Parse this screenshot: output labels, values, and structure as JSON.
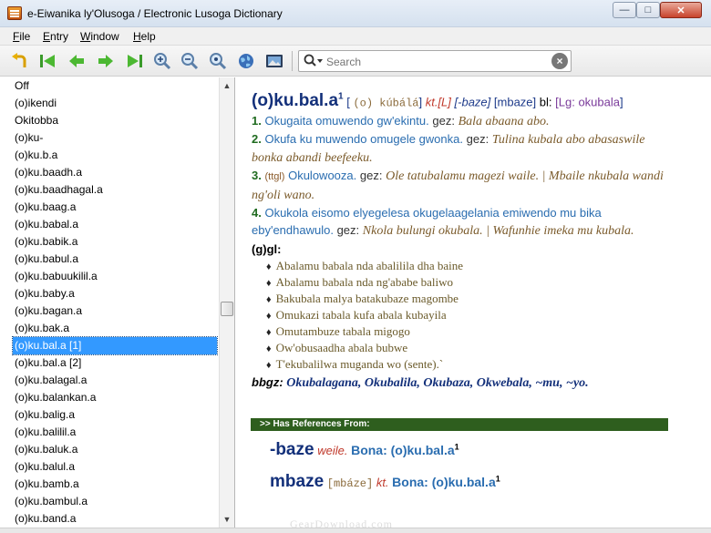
{
  "window": {
    "title": "e-Eiwanika ly'Olusoga / Electronic Lusoga Dictionary",
    "min_label": "—",
    "max_label": "□",
    "close_label": "✕"
  },
  "menu": {
    "items": [
      {
        "label": "File",
        "key": "F",
        "rest": "ile"
      },
      {
        "label": "Entry",
        "key": "E",
        "rest": "ntry"
      },
      {
        "label": "Window",
        "key": "W",
        "rest": "indow"
      },
      {
        "label": "Help",
        "key": "H",
        "rest": "elp"
      }
    ]
  },
  "toolbar": {
    "icons": [
      "undo-icon",
      "first-icon",
      "back-icon",
      "forward-icon",
      "last-icon",
      "zoom-in-icon",
      "zoom-out-icon",
      "zoom-reset-icon",
      "globe-icon",
      "image-icon"
    ],
    "search_placeholder": "Search"
  },
  "word_list": {
    "items": [
      "Off",
      "(o)ikendi",
      "Okitobba",
      "(o)ku-",
      "(o)ku.b.a",
      "(o)ku.baadh.a",
      "(o)ku.baadhagal.a",
      "(o)ku.baag.a",
      "(o)ku.babal.a",
      "(o)ku.babik.a",
      "(o)ku.babul.a",
      "(o)ku.babuukilil.a",
      "(o)ku.baby.a",
      "(o)ku.bagan.a",
      "(o)ku.bak.a",
      "(o)ku.bal.a [1]",
      "(o)ku.bal.a [2]",
      "(o)ku.balagal.a",
      "(o)ku.balankan.a",
      "(o)ku.balig.a",
      "(o)ku.balilil.a",
      "(o)ku.baluk.a",
      "(o)ku.balul.a",
      "(o)ku.bamb.a",
      "(o)ku.bambul.a",
      "(o)ku.band.a"
    ],
    "selected_index": 15
  },
  "entry": {
    "headword": "(o)ku.bal.a",
    "homonym": "1",
    "open_bracket": "[",
    "pron": "(o) kúbálá",
    "pos": "kt.[L]",
    "variant1": "[-baze]",
    "variant2": "[mbaze]",
    "bl_label": "bl:",
    "lg": "[Lg:",
    "lg_form": "okubala",
    "close_bracket": "]",
    "senses": [
      {
        "num": "1.",
        "def": "Okugaita omuwendo gw'ekintu.",
        "gez": "gez:",
        "ex": "Bala abaana abo."
      },
      {
        "num": "2.",
        "def": "Okufa ku muwendo omugele gwonka.",
        "gez": "gez:",
        "ex": "Tulina kubala abo abasaswile bonka abandi beefeeku."
      },
      {
        "num": "3.",
        "tag": "(ttgl)",
        "def": "Okulowooza.",
        "gez": "gez:",
        "ex": "Ole tatubalamu magezi waile. | Mbaile nkubala wandi ng'oli wano."
      },
      {
        "num": "4.",
        "def": "Okukola eisomo elyegelesa okugelaagelania emiwendo mu bika eby'endhawulo.",
        "gez": "gez:",
        "ex": "Nkola bulungi okubala. | Wafunhie imeka mu kubala."
      }
    ],
    "gl_heading": "(g)gl:",
    "gl_items": [
      "Abalamu babala nda abalilila dha baine",
      "Abalamu babala nda ng'ababe baliwo",
      "Bakubala malya batakubaze magombe",
      "Omukazi tabala kufa abala kubayila",
      "Omutambuze tabala migogo",
      "Ow'obusaadha abala bubwe",
      "T'ekubalilwa muganda wo (sente).`"
    ],
    "bbgz_label": "bbgz:",
    "bbgz_forms": "Okubalagana, Okubalila, Okubaza, Okwebala, ~mu, ~yo."
  },
  "references": {
    "bar_label": ">> Has References From:",
    "items": [
      {
        "hw": "-baze",
        "pron": "",
        "pos": "weile.",
        "bona": "Bona: (o)ku.bal.a",
        "sup": "1"
      },
      {
        "hw": "mbaze",
        "pron": "[mbáze]",
        "pos": "kt.",
        "bona": "Bona: (o)ku.bal.a",
        "sup": "1"
      }
    ]
  },
  "watermark": "GearDownload.com",
  "colors": {
    "headword": "#13307a",
    "definition": "#2a6db0",
    "sense_number": "#1f6b1f",
    "example": "#7a5a2a",
    "ref_bar": "#2e5e1e",
    "selection": "#3399ff"
  }
}
